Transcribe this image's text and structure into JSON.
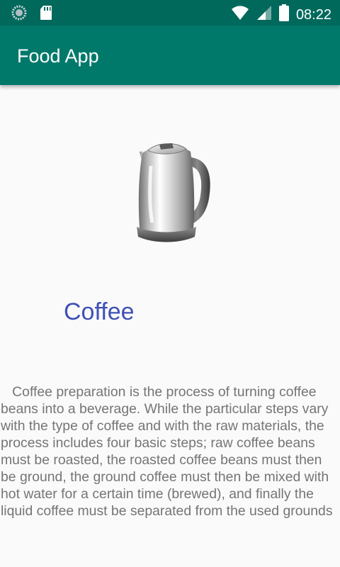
{
  "status_bar": {
    "time": "08:22",
    "icons": [
      "data-saver-icon",
      "sd-card-icon",
      "wifi-icon",
      "signal-icon",
      "battery-icon"
    ]
  },
  "app_bar": {
    "title": "Food App"
  },
  "food": {
    "image_icon": "kettle-icon",
    "title": "Coffee",
    "description": "   Coffee preparation is the process of turning coffee beans into a beverage. While the particular steps vary with the type of coffee and with the raw materials, the process includes four basic steps; raw coffee beans must be roasted, the roasted coffee beans must then be ground, the ground coffee must then be mixed with hot water for a certain time (brewed), and finally the liquid coffee must be separated from the used grounds"
  },
  "colors": {
    "status_bar": "#00695c",
    "app_bar": "#00796b",
    "title_text": "#3f51b5",
    "body_text": "#757575",
    "background": "#fafafa"
  }
}
